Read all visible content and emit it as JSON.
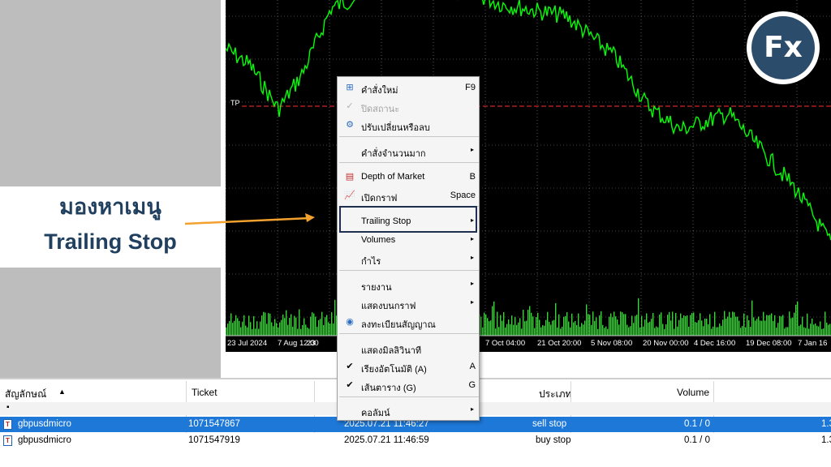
{
  "annotation": {
    "title": "มองหาเมนู",
    "subtitle": "Trailing Stop",
    "arrow_color": "#f2a12e"
  },
  "chart": {
    "tp_label": "TP",
    "x_labels": [
      "23 Jul 2024",
      "7 Aug 12:00",
      "23",
      "7 Oct 04:00",
      "21 Oct 20:00",
      "5 Nov 08:00",
      "20 Nov 00:00",
      "4 Dec 16:00",
      "19 Dec 08:00",
      "7 Jan 16"
    ],
    "line_color": "#00ff00",
    "tp_color": "#ff3030"
  },
  "logo": {
    "text": "Fx"
  },
  "table": {
    "headers": [
      "สัญลักษณ์",
      "Ticket",
      "ประเภท",
      "Volume"
    ],
    "sort_indicator": "▲",
    "group_marker": "▪",
    "rows": [
      {
        "symbol": "gbpusdmicro",
        "ticket": "1071547867",
        "time": "2025.07.21 11:46:27",
        "type": "sell stop",
        "volume": "0.1 / 0",
        "price": "1.3"
      },
      {
        "symbol": "gbpusdmicro",
        "ticket": "1071547919",
        "time": "2025.07.21 11:46:59",
        "type": "buy stop",
        "volume": "0.1 / 0",
        "price": "1.3"
      }
    ]
  },
  "menu": {
    "new_order": "คำสั่งใหม่",
    "new_order_key": "F9",
    "close_position": "ปิดสถานะ",
    "modify": "ปรับเปลี่ยนหรือลบ",
    "bulk": "คำสั่งจำนวนมาก",
    "depth": "Depth of Market",
    "depth_key": "B",
    "open_chart": "เปิดกราฟ",
    "open_chart_key": "Space",
    "trailing": "Trailing Stop",
    "volumes": "Volumes",
    "profit": "กำไร",
    "report": "รายงาน",
    "show_on_chart": "แสดงบนกราฟ",
    "subscribe": "ลงทะเบียนสัญญาณ",
    "show_ms": "แสดงมิลลิวินาที",
    "auto_arrange": "เรียงอัตโนมัติ (A)",
    "auto_arrange_key": "A",
    "grid": "เส้นตาราง (G)",
    "grid_key": "G",
    "columns": "คอลัมน์",
    "submenu_arrow": "▸",
    "check": "✔"
  }
}
